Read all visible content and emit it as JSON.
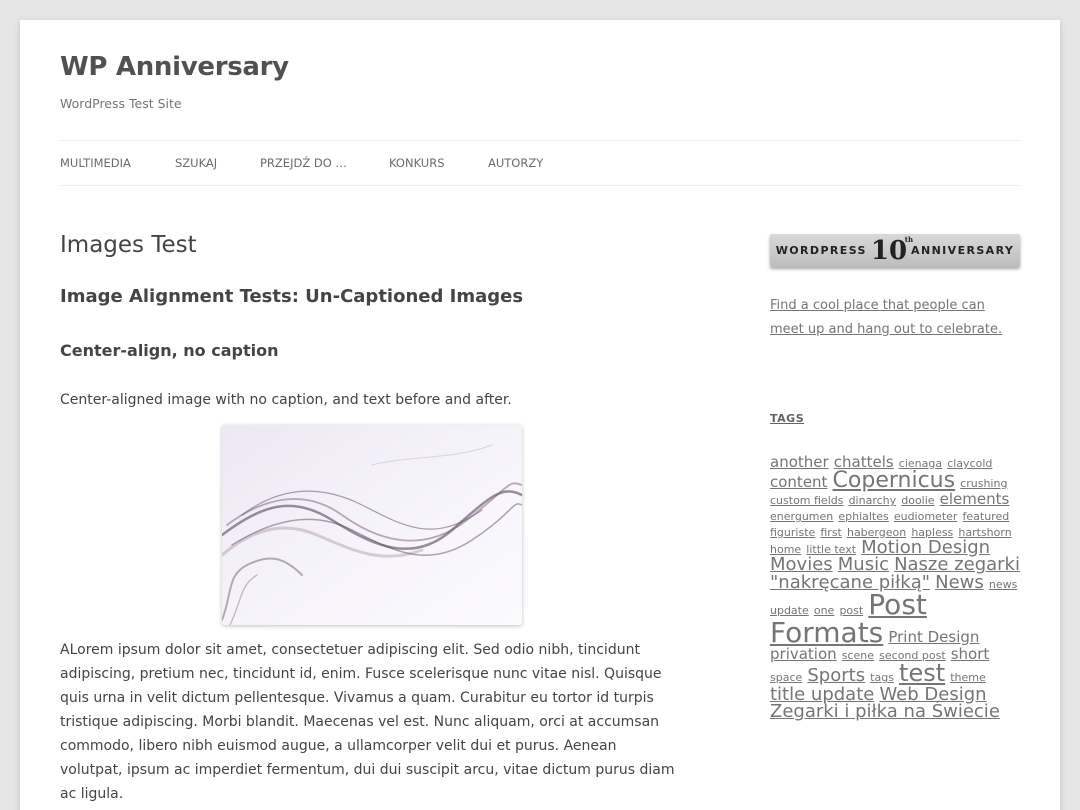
{
  "site": {
    "title": "WP Anniversary",
    "description": "WordPress Test Site"
  },
  "nav": [
    "Multimedia",
    "Szukaj",
    "Przejdź do …",
    "Konkurs",
    "Autorzy"
  ],
  "post": {
    "page_title": "Images Test",
    "heading": "Image Alignment Tests: Un-Captioned Images",
    "subheading": "Center-align, no caption",
    "intro": "Center-aligned image with no caption, and text before and after.",
    "body": "ALorem ipsum dolor sit amet, consectetuer adipiscing elit. Sed odio nibh, tincidunt adipiscing, pretium nec, tincidunt id, enim. Fusce scelerisque nunc vitae nisl. Quisque quis urna in velit dictum pellentesque. Vivamus a quam. Curabitur eu tortor id turpis tristique adipiscing. Morbi blandit. Maecenas vel est. Nunc aliquam, orci at accumsan commodo, libero nibh euismod augue, a ullamcorper velit dui et purus. Aenean volutpat, ipsum ac imperdiet fermentum, dui dui suscipit arcu, vitae dictum purus diam ac ligula."
  },
  "sidebar": {
    "badge": {
      "left": "WORDPRESS",
      "number": "10",
      "sup": "th",
      "right": "ANNIVERSARY"
    },
    "cta": "Find a cool place that people can meet up and hang out to celebrate.",
    "tags_title": "Tags",
    "tags": [
      {
        "label": "another",
        "size": 15
      },
      {
        "label": "chattels",
        "size": 15
      },
      {
        "label": "cienaga",
        "size": 11
      },
      {
        "label": "claycold",
        "size": 11
      },
      {
        "label": "content",
        "size": 15
      },
      {
        "label": "Copernicus",
        "size": 22
      },
      {
        "label": "crushing",
        "size": 11
      },
      {
        "label": "custom fields",
        "size": 11
      },
      {
        "label": "dinarchy",
        "size": 11
      },
      {
        "label": "doolie",
        "size": 11
      },
      {
        "label": "elements",
        "size": 15
      },
      {
        "label": "energumen",
        "size": 11
      },
      {
        "label": "ephialtes",
        "size": 11
      },
      {
        "label": "eudiometer",
        "size": 11
      },
      {
        "label": "featured",
        "size": 11
      },
      {
        "label": "figuriste",
        "size": 11
      },
      {
        "label": "first",
        "size": 11
      },
      {
        "label": "habergeon",
        "size": 11
      },
      {
        "label": "hapless",
        "size": 11
      },
      {
        "label": "hartshorn",
        "size": 11
      },
      {
        "label": "home",
        "size": 11
      },
      {
        "label": "little text",
        "size": 11
      },
      {
        "label": "Motion Design",
        "size": 18
      },
      {
        "label": "Movies",
        "size": 18
      },
      {
        "label": "Music",
        "size": 18
      },
      {
        "label": "Nasze zegarki \"nakręcane piłką\"",
        "size": 18
      },
      {
        "label": "News",
        "size": 18
      },
      {
        "label": "news update",
        "size": 11
      },
      {
        "label": "one",
        "size": 11
      },
      {
        "label": "post",
        "size": 11
      },
      {
        "label": "Post Formats",
        "size": 28
      },
      {
        "label": "Print Design",
        "size": 15
      },
      {
        "label": "privation",
        "size": 15
      },
      {
        "label": "scene",
        "size": 11
      },
      {
        "label": "second post",
        "size": 11
      },
      {
        "label": "short",
        "size": 15
      },
      {
        "label": "space",
        "size": 11
      },
      {
        "label": "Sports",
        "size": 18
      },
      {
        "label": "tags",
        "size": 11
      },
      {
        "label": "test",
        "size": 24
      },
      {
        "label": "theme",
        "size": 11
      },
      {
        "label": "title update",
        "size": 18
      },
      {
        "label": "Web Design",
        "size": 18
      },
      {
        "label": "Zegarki i piłka na Świecie",
        "size": 18
      }
    ]
  }
}
